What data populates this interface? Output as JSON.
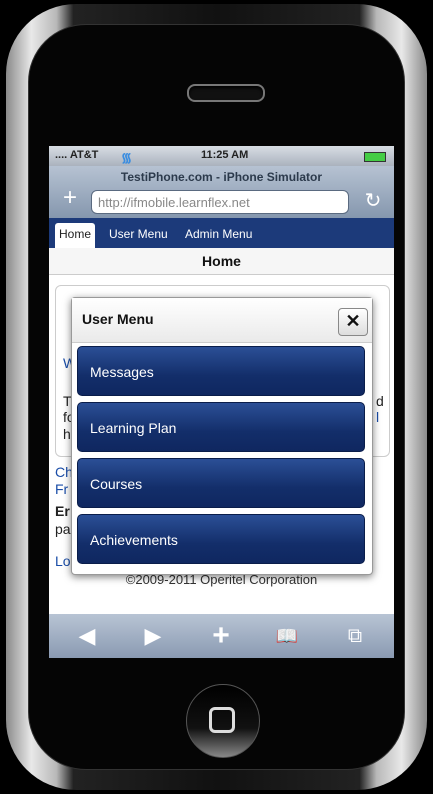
{
  "status": {
    "carrier": ".... AT&T",
    "wifi_icon": "wifi-icon",
    "time": "11:25 AM"
  },
  "browser": {
    "title": "TestiPhone.com - iPhone Simulator",
    "url": "http://ifmobile.learnflex.net"
  },
  "nav": {
    "tabs": [
      "Home",
      "User Menu",
      "Admin Menu"
    ],
    "active": "Home"
  },
  "page": {
    "title": "Home",
    "background_fragments": {
      "w": "W",
      "t": "T",
      "fo": "fo",
      "h": "h",
      "d": "d",
      "l": "l",
      "ch": "Ch",
      "fr": "Fr",
      "er": "Er",
      "pa": "pa"
    },
    "logout": "Logout",
    "copyright": "©2009-2011 Operitel Corporation"
  },
  "popup": {
    "title": "User Menu",
    "close_label": "✕",
    "items": [
      "Messages",
      "Learning Plan",
      "Courses",
      "Achievements"
    ]
  },
  "toolbar": {
    "back": "◀",
    "forward": "▶",
    "add": "+",
    "bookmarks": "📖",
    "pages": "⧉"
  },
  "colors": {
    "nav_bg": "#1c3a7a",
    "button_bg": "#132e6a",
    "link": "#1a4da8"
  }
}
